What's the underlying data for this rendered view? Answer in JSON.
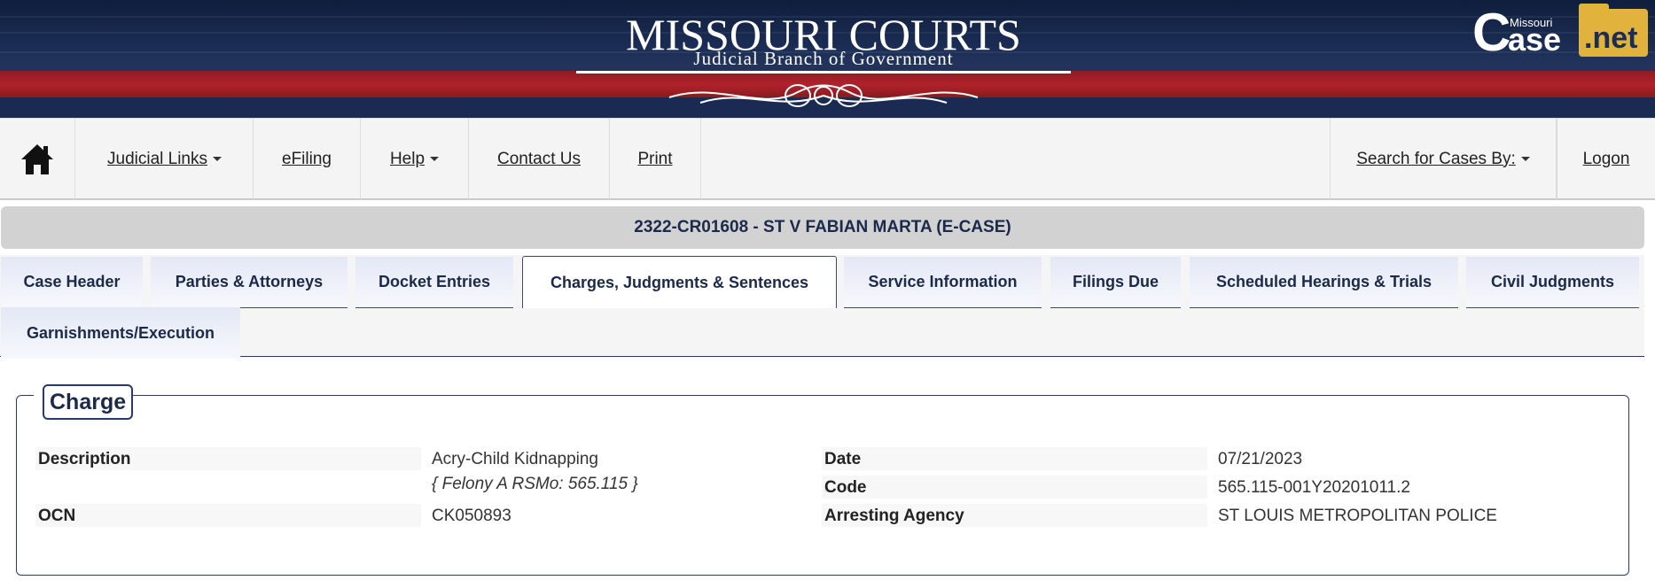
{
  "banner": {
    "title": "MISSOURI COURTS",
    "subtitle": "Judicial Branch of Government",
    "casenet_missouri": "Missouri",
    "casenet_c": "C",
    "casenet_ase": "ase",
    "casenet_net": ".net"
  },
  "nav": {
    "home_icon": "home-icon",
    "judicial_links": "Judicial Links",
    "efiling": "eFiling",
    "help": "Help",
    "contact": "Contact Us",
    "print": "Print",
    "search": "Search for Cases By:",
    "logon": "Logon"
  },
  "case": {
    "title": "2322-CR01608 - ST V FABIAN MARTA (E-CASE)"
  },
  "tabs": [
    {
      "label": "Case Header"
    },
    {
      "label": "Parties & Attorneys"
    },
    {
      "label": "Docket Entries"
    },
    {
      "label": "Charges, Judgments & Sentences"
    },
    {
      "label": "Service Information"
    },
    {
      "label": "Filings Due"
    },
    {
      "label": "Scheduled Hearings & Trials"
    },
    {
      "label": "Civil Judgments"
    },
    {
      "label": "Garnishments/Execution"
    }
  ],
  "charge": {
    "legend": "Charge",
    "description_label": "Description",
    "description_value": "Acry-Child Kidnapping",
    "description_detail": "{ Felony A RSMo: 565.115 }",
    "ocn_label": "OCN",
    "ocn_value": "CK050893",
    "date_label": "Date",
    "date_value": "07/21/2023",
    "code_label": "Code",
    "code_value": "565.115-001Y20201011.2",
    "agency_label": "Arresting Agency",
    "agency_value": "ST LOUIS METROPOLITAN POLICE"
  },
  "colors": {
    "navy": "#1b2d55",
    "red": "#b0222b",
    "tab_text": "#1b2a4a",
    "gold": "#e2b33c"
  }
}
